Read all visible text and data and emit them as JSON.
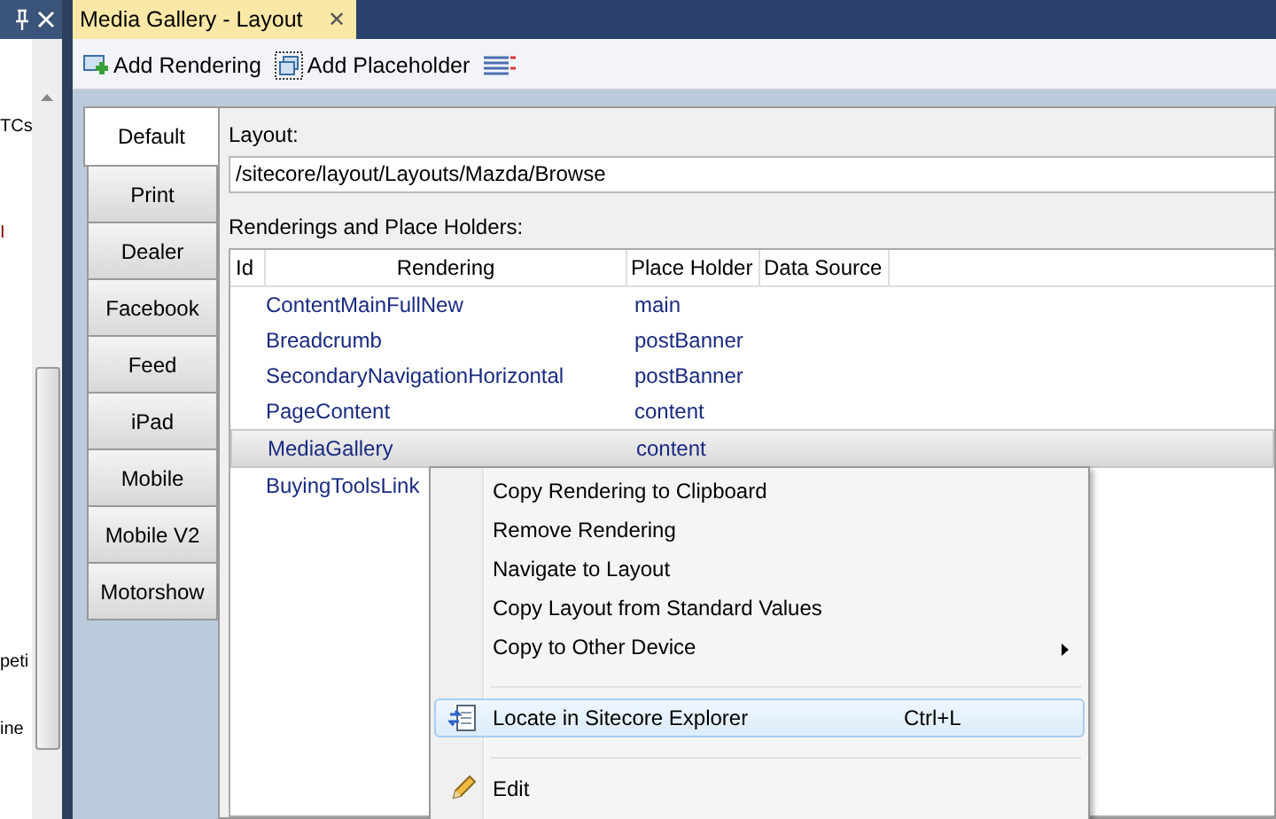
{
  "side_panel": {
    "fragments": [
      "TCs",
      "I",
      "peti",
      "ine"
    ]
  },
  "document_tab": {
    "title": "Media Gallery - Layout",
    "close": "✕"
  },
  "toolbar": [
    {
      "kind": "add-rendering",
      "label": "Add Rendering"
    },
    {
      "kind": "add-placeholder",
      "label": "Add Placeholder"
    },
    {
      "kind": "list"
    }
  ],
  "device_tabs": [
    {
      "label": "Default",
      "selected": true
    },
    {
      "label": "Print",
      "selected": false
    },
    {
      "label": "Dealer",
      "selected": false
    },
    {
      "label": "Facebook",
      "selected": false
    },
    {
      "label": "Feed",
      "selected": false
    },
    {
      "label": "iPad",
      "selected": false
    },
    {
      "label": "Mobile",
      "selected": false
    },
    {
      "label": "Mobile V2",
      "selected": false
    },
    {
      "label": "Motorshow",
      "selected": false
    }
  ],
  "layout": {
    "label": "Layout:",
    "value": "/sitecore/layout/Layouts/Mazda/Browse"
  },
  "renderings": {
    "label": "Renderings and Place Holders:",
    "columns": [
      "Id",
      "Rendering",
      "Place Holder",
      "Data Source"
    ],
    "rows": [
      {
        "rendering": "ContentMainFullNew",
        "placeholder": "main",
        "selected": false
      },
      {
        "rendering": "Breadcrumb",
        "placeholder": "postBanner",
        "selected": false
      },
      {
        "rendering": "SecondaryNavigationHorizontal",
        "placeholder": "postBanner",
        "selected": false
      },
      {
        "rendering": "PageContent",
        "placeholder": "content",
        "selected": false
      },
      {
        "rendering": "MediaGallery",
        "placeholder": "content",
        "selected": true
      },
      {
        "rendering": "BuyingToolsLink",
        "selected": false
      }
    ]
  },
  "context_menu": [
    {
      "kind": "item",
      "label": "Copy Rendering to Clipboard",
      "highlighted": false
    },
    {
      "kind": "item",
      "label": "Remove Rendering",
      "highlighted": false
    },
    {
      "kind": "item",
      "label": "Navigate to Layout",
      "highlighted": false
    },
    {
      "kind": "item",
      "label": "Copy Layout from Standard Values",
      "highlighted": false
    },
    {
      "kind": "item",
      "label": "Copy to Other Device",
      "submenu": true,
      "highlighted": false
    },
    {
      "kind": "separator"
    },
    {
      "kind": "explorer",
      "label": "Locate in Sitecore Explorer",
      "shortcut": "Ctrl+L",
      "highlighted": true
    },
    {
      "kind": "separator"
    },
    {
      "kind": "edit",
      "label": "Edit",
      "highlighted": false
    }
  ]
}
